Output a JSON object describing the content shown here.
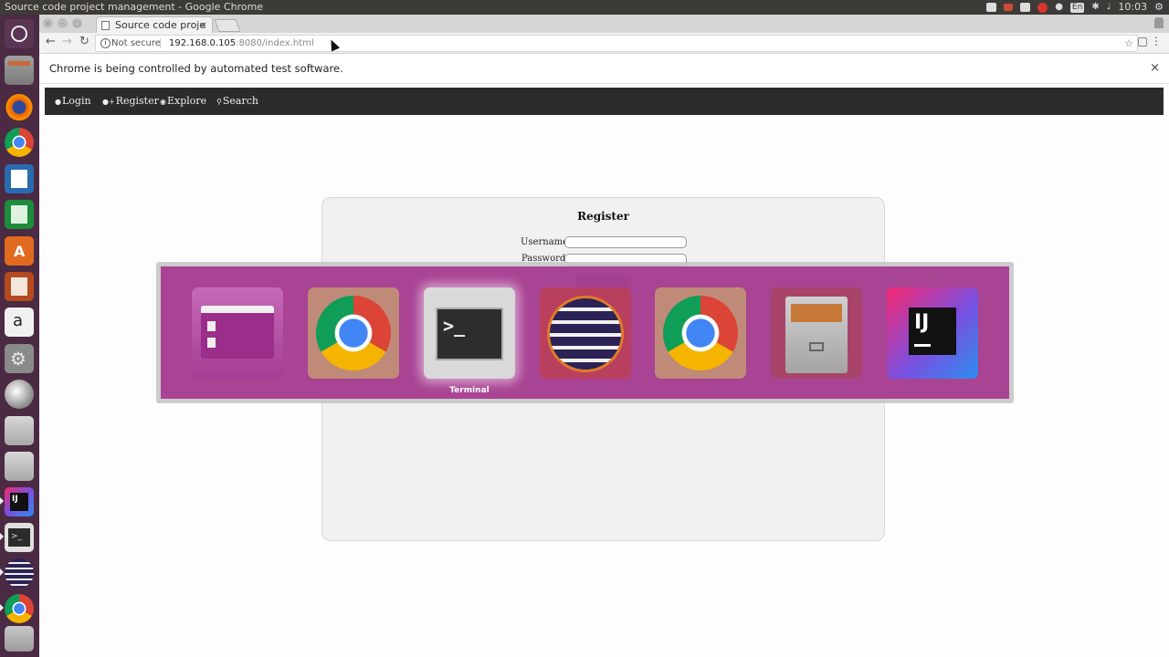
{
  "os": {
    "window_title": "Source code project management - Google Chrome",
    "clock": "10:03",
    "keyboard_layout": "En"
  },
  "launcher": {
    "apps": [
      "ubuntu-dash",
      "files",
      "firefox",
      "chrome",
      "writer",
      "calc",
      "software-center",
      "impress",
      "amazon",
      "system-settings",
      "disk-tool",
      "drive",
      "drive",
      "intellij",
      "terminal",
      "eclipse",
      "chrome",
      "trash"
    ]
  },
  "browser": {
    "tab_title": "Source code proje",
    "security": "Not secure",
    "url_host": "192.168.0.105",
    "url_path": ":8080/index.html",
    "infobar": "Chrome is being controlled by automated test software."
  },
  "site": {
    "nav": [
      {
        "label": "Login",
        "icon": "user-icon"
      },
      {
        "label": "Register",
        "icon": "add-user-icon"
      },
      {
        "label": "Explore",
        "icon": "eye-icon"
      },
      {
        "label": "Search",
        "icon": "search-icon"
      }
    ],
    "form": {
      "title": "Register",
      "username_label": "Username",
      "password_label": "Password",
      "username_value": "",
      "password_value": ""
    }
  },
  "switcher": {
    "apps": [
      {
        "icon": "nautilus-icon"
      },
      {
        "icon": "chrome-icon"
      },
      {
        "icon": "terminal-icon",
        "label": "Terminal",
        "selected": true
      },
      {
        "icon": "eclipse-icon"
      },
      {
        "icon": "chrome-icon"
      },
      {
        "icon": "file-cabinet-icon"
      },
      {
        "icon": "intellij-icon"
      }
    ]
  },
  "colors": {
    "panel": "#3c3b37",
    "launcher": "#4b2a44",
    "switcher": "#a4308c",
    "site_nav": "#2b2b2b"
  }
}
